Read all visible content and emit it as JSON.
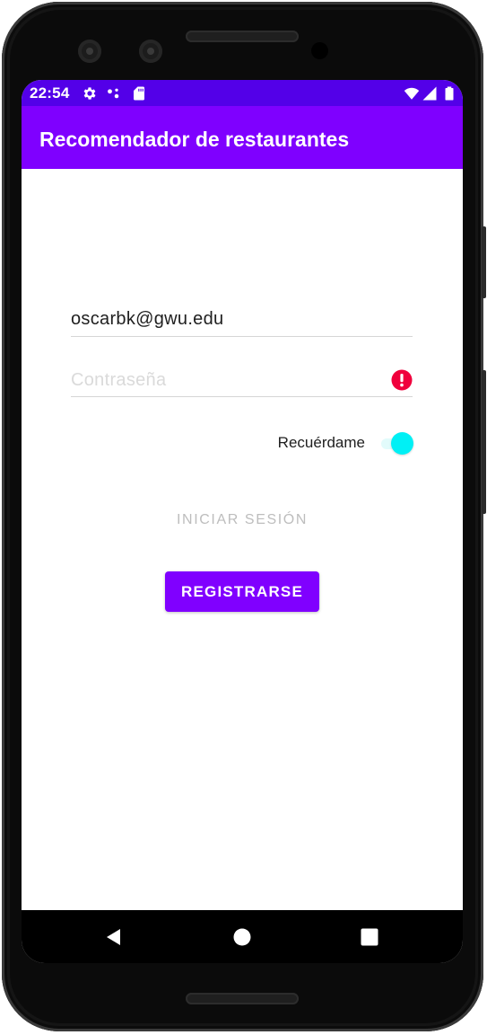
{
  "status_bar": {
    "time": "22:54",
    "icons": [
      "gear-icon",
      "assistant-dots-icon",
      "sd-card-icon",
      "wifi-icon",
      "signal-icon",
      "battery-icon"
    ]
  },
  "app_bar": {
    "title": "Recomendador de restaurantes"
  },
  "login_form": {
    "email": {
      "value": "oscarbk@gwu.edu",
      "placeholder": ""
    },
    "password": {
      "value": "",
      "placeholder": "Contraseña",
      "error_icon": "error-icon"
    },
    "remember_me": {
      "label": "Recuérdame",
      "on": true
    },
    "login_button": {
      "label": "INICIAR SESIÓN",
      "enabled": false
    },
    "register_button": {
      "label": "REGISTRARSE"
    }
  },
  "nav_bar": {
    "buttons": [
      "back-icon",
      "home-icon",
      "recents-icon"
    ]
  },
  "colors": {
    "status_bar": "#5300e8",
    "app_bar": "#7f00ff",
    "primary_button": "#8000ff",
    "switch_thumb": "#00f0f5",
    "error": "#f0003c"
  }
}
